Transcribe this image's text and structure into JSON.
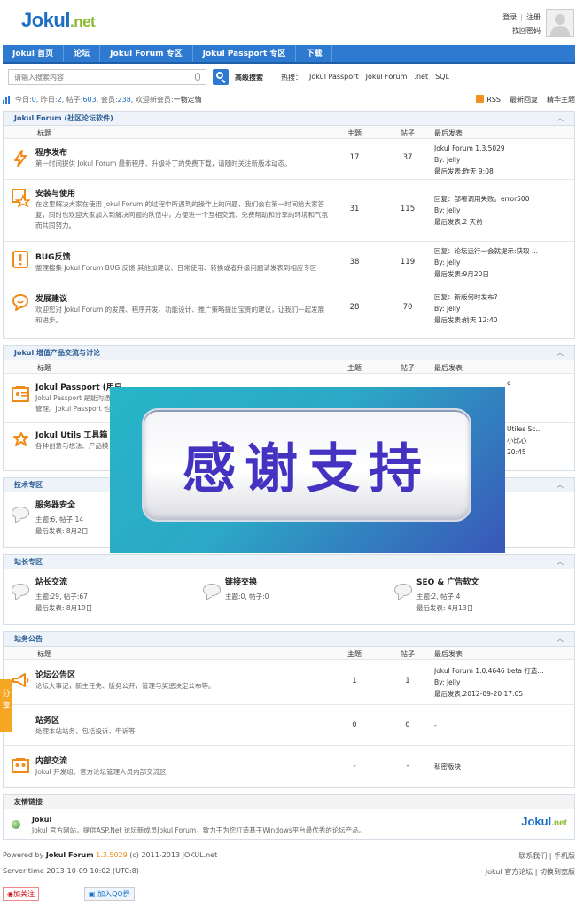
{
  "header": {
    "logo_main": "Jokul",
    "logo_net": ".net",
    "login": "登录",
    "register": "注册",
    "forgot": "找回密码"
  },
  "nav": [
    "Jokul 首页",
    "论坛",
    "Jokul Forum 专区",
    "Jokul Passport 专区",
    "下载"
  ],
  "search": {
    "placeholder": "请输入搜索内容",
    "advanced": "高级搜索",
    "hot_label": "热搜：",
    "hot": [
      "Jokul Passport",
      "Jokul Forum",
      ".net",
      "SQL"
    ]
  },
  "stats": {
    "today_label": "今日: ",
    "today": "0",
    "yesterday_label": ", 昨日: ",
    "yesterday": "2",
    "posts_label": ", 帖子: ",
    "posts": "603",
    "members_label": ", 会员: ",
    "members": "238",
    "newest_label": ", 欢迎新会员: ",
    "newest": "一物定情",
    "rss": "RSS",
    "latest_reply": "最新回复",
    "featured": "精华主题"
  },
  "columns": {
    "title": "标题",
    "topics": "主题",
    "posts": "帖子",
    "last": "最后发表"
  },
  "board1": {
    "title": "Jokul Forum (社区论坛软件)",
    "forums": [
      {
        "name": "程序发布",
        "desc": "第一时间提供 Jokul Forum 最新程序、升级补丁的免费下载，请随时关注新版本动态。",
        "topics": "17",
        "posts": "37",
        "last1": "Jokul Forum 1.3.5029",
        "last2": "By: Jelly",
        "last3": "最后发表:昨天 9:08"
      },
      {
        "name": "安装与使用",
        "desc": "在这里解决大家在使用 Jokul Forum 的过程中所遇到的操作上的问题，我们会在第一时间给大家答复，同时也欢迎大家加入到解决问题的队伍中，方便进一个互相交流、免费帮助和分享的环境和气氛而共同努力。",
        "topics": "31",
        "posts": "115",
        "last1": "回复：部署调用失败。error500",
        "last2": "By: Jelly",
        "last3": "最后发表:2 天前"
      },
      {
        "name": "BUG反馈",
        "desc": "整理搜集 Jokul Forum BUG 反馈,其他加建议、日常使用、转换或者升级问题请发表到相应专区",
        "topics": "38",
        "posts": "119",
        "last1": "回复：论坛运行一会就提示:获取 ...",
        "last2": "By: Jelly",
        "last3": "最后发表:9月20日"
      },
      {
        "name": "发展建议",
        "desc": "欢迎您对 Jokul Forum 的发展、程序开发、功能设计、推广策略提出宝贵的建议，让我们一起发展和进步。",
        "topics": "28",
        "posts": "70",
        "last1": "回复：新版何时发布?",
        "last2": "By: Jelly",
        "last3": "最后发表:前天 12:40"
      }
    ]
  },
  "board2": {
    "title": "Jokul 增值产品交流与讨论",
    "forums": [
      {
        "name": "Jokul Passport (用户",
        "desc1": "Jokul Passport 是能沟通",
        "desc2": "管理。Jokul Passport 也",
        "last1": "e",
        "last2": "",
        "last3": ""
      },
      {
        "name": "Jokul Utils 工具箱",
        "desc1": "各种创意与想法、产品模",
        "desc2": "",
        "last1": "Utiles Sc...",
        "last2": "小比心",
        "last3": "20:45"
      }
    ]
  },
  "board3": {
    "title": "技术专区",
    "forums": [
      {
        "name": "服务器安全",
        "line1": "主题:6, 帖子:14",
        "line2": "最后发表: 8月2日"
      }
    ]
  },
  "board4": {
    "title": "站长专区",
    "forums": [
      {
        "name": "站长交流",
        "line1": "主题:29, 帖子:67",
        "line2": "最后发表: 8月19日"
      },
      {
        "name": "链接交换",
        "line1": "主题:0, 帖子:0",
        "line2": ""
      },
      {
        "name": "SEO & 广告软文",
        "line1": "主题:2, 帖子:4",
        "line2": "最后发表: 4月13日"
      }
    ]
  },
  "board5": {
    "title": "站务公告",
    "forums": [
      {
        "name": "论坛公告区",
        "desc": "论坛大事记，新主任免、版务公开，管理与奖惩决定公布等。",
        "topics": "1",
        "posts": "1",
        "last1": "Jokul Forum 1.0.4646 beta 打造...",
        "last2": "By: Jelly",
        "last3": "最后发表:2012-09-20 17:05"
      },
      {
        "name": "站务区",
        "desc": "处理本站站务，包括投诉、申诉等",
        "topics": "0",
        "posts": "0",
        "last1": "-",
        "last2": "",
        "last3": ""
      },
      {
        "name": "内部交流",
        "desc": "Jokul 开发组、官方论坛管理人员内部交流区",
        "topics": "-",
        "posts": "-",
        "last1": "私密版块",
        "last2": "",
        "last3": ""
      }
    ]
  },
  "links": {
    "title": "友情链接",
    "name": "Jokul",
    "desc": "Jokul 官方网站，提供ASP.Net 论坛新成员Jokul Forum，致力于为您打造基于Windows平台最优秀的论坛产品。",
    "logo": "Jokul",
    "logo_net": ".net"
  },
  "overlay": {
    "text": "感谢支持"
  },
  "share": "分享",
  "footer": {
    "powered": "Powered by ",
    "product": "Jokul Forum",
    "version": "1.3.5029",
    "copy": "(c) 2011-2013 JOKUL.net",
    "server_time": "Server time 2013-10-09 10:02 (UTC:8)",
    "contact": "联系我们",
    "mobile": "手机版",
    "official": "Jokul 官方论坛",
    "switch_width": "切换到宽版",
    "follow": "加关注",
    "qq": "加入QQ群"
  }
}
